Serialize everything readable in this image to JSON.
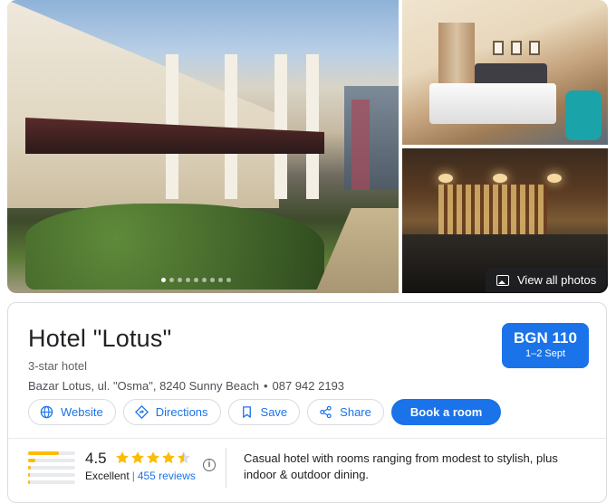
{
  "gallery": {
    "view_all_label": "View all photos",
    "dot_count": 9,
    "active_dot": 0
  },
  "hotel": {
    "name": "Hotel \"Lotus\"",
    "category": "3-star hotel",
    "address": "Bazar Lotus, ul. \"Osma\", 8240 Sunny Beach",
    "phone": "087 942 2193"
  },
  "price": {
    "amount": "BGN 110",
    "dates": "1–2 Sept"
  },
  "actions": {
    "website": "Website",
    "directions": "Directions",
    "save": "Save",
    "share": "Share",
    "book": "Book a room"
  },
  "rating": {
    "score": "4.5",
    "score_value": 4.5,
    "label": "Excellent",
    "reviews": "455 reviews",
    "distribution": [
      0.65,
      0.15,
      0.05,
      0.03,
      0.04
    ]
  },
  "description": "Casual hotel with rooms ranging from modest to stylish, plus indoor & outdoor dining.",
  "colors": {
    "accent": "#1a73e8",
    "star": "#fbbc04"
  }
}
